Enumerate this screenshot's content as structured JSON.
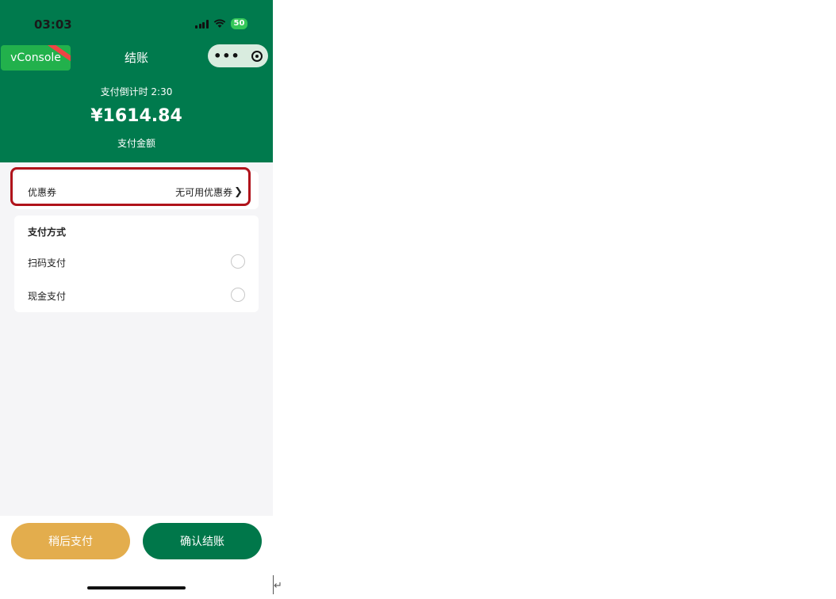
{
  "status_bar": {
    "time": "03:03",
    "battery": "50"
  },
  "vconsole": {
    "label": "vConsole"
  },
  "nav": {
    "title": "结账"
  },
  "header": {
    "countdown": "支付倒计时 2:30",
    "amount": "¥1614.84",
    "amount_label": "支付金额"
  },
  "coupon": {
    "label": "优惠券",
    "value": "无可用优惠券",
    "chevron": "❯"
  },
  "payment": {
    "title": "支付方式",
    "methods": [
      {
        "label": "扫码支付",
        "selected": false
      },
      {
        "label": "现金支付",
        "selected": false
      }
    ]
  },
  "footer": {
    "later_label": "稍后支付",
    "confirm_label": "确认结账"
  },
  "colors": {
    "brand_green": "#007a4d",
    "later_button": "#e3ad4d",
    "confirm_button": "#00774a",
    "highlight_border": "#b0131b"
  },
  "icons": [
    "signal-icon",
    "wifi-icon",
    "battery-icon",
    "more-dots-icon",
    "close-target-icon",
    "chevron-right-icon",
    "radio-icon",
    "return-icon"
  ]
}
